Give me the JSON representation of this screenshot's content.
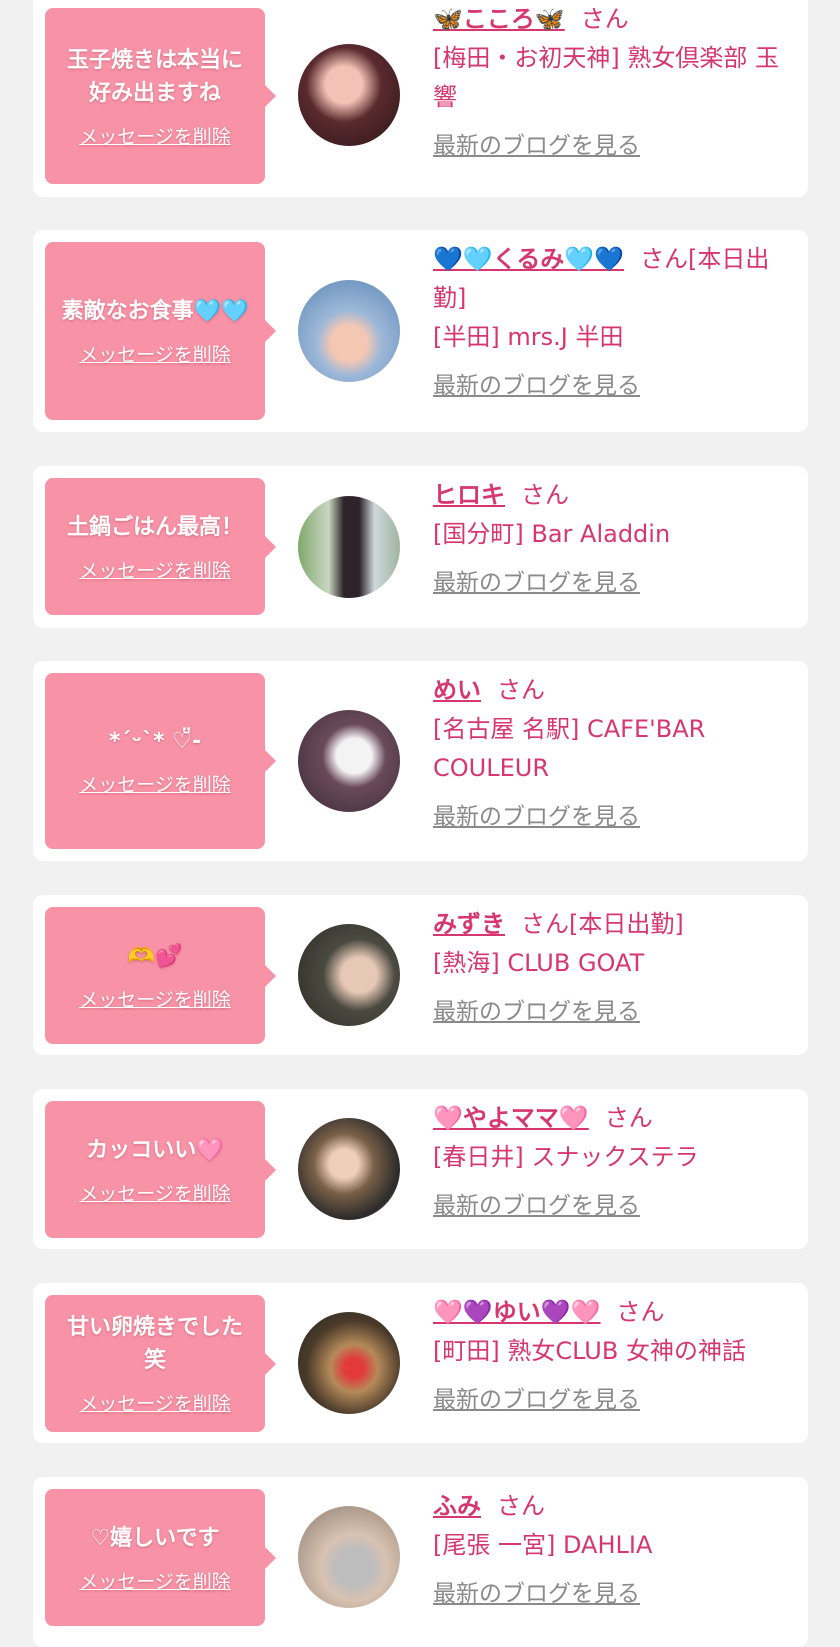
{
  "items": [
    {
      "message": "玉子焼きは本当に好み出ますね",
      "delete": "メッセージを削除",
      "name": "🦋こころ🦋",
      "suffix": "さん",
      "shop": "[梅田・お初天神] 熟女倶楽部 玉響",
      "blog": "最新のブログを見る"
    },
    {
      "message": "素敵なお食事🩵🩵",
      "delete": "メッセージを削除",
      "name": "💙🩵くるみ🩵💙",
      "suffix": "さん[本日出勤]",
      "shop": "[半田] mrs.J 半田",
      "blog": "最新のブログを見る"
    },
    {
      "message": "土鍋ごはん最高！",
      "delete": "メッセージを削除",
      "name": "ヒロキ",
      "suffix": "さん",
      "shop": "[国分町] Bar Aladdin",
      "blog": "最新のブログを見る"
    },
    {
      "message": "*´ᵕ`* ♡̆̈-",
      "delete": "メッセージを削除",
      "name": "めい",
      "suffix": "さん",
      "shop": "[名古屋 名駅] CAFE'BAR COULEUR",
      "blog": "最新のブログを見る"
    },
    {
      "message": "🫶💕",
      "delete": "メッセージを削除",
      "name": "みずき",
      "suffix": "さん[本日出勤]",
      "shop": "[熱海] CLUB GOAT",
      "blog": "最新のブログを見る"
    },
    {
      "message": "カッコいい🩷",
      "delete": "メッセージを削除",
      "name": "🩷やよママ🩷",
      "suffix": "さん",
      "shop": "[春日井] スナックステラ",
      "blog": "最新のブログを見る"
    },
    {
      "message": "甘い卵焼きでした笑",
      "delete": "メッセージを削除",
      "name": "🩷💜ゆい💜🩷",
      "suffix": "さん",
      "shop": "[町田] 熟女CLUB 女神の神話",
      "blog": "最新のブログを見る"
    },
    {
      "message": "♡嬉しいです",
      "delete": "メッセージを削除",
      "name": "ふみ",
      "suffix": "さん",
      "shop": "[尾張 一宮] DAHLIA",
      "blog": "最新のブログを見る"
    }
  ],
  "colors": {
    "bubble": "#f892a6",
    "accent": "#d6376c",
    "link": "#8a8a8a",
    "background": "#f1f1f1"
  }
}
